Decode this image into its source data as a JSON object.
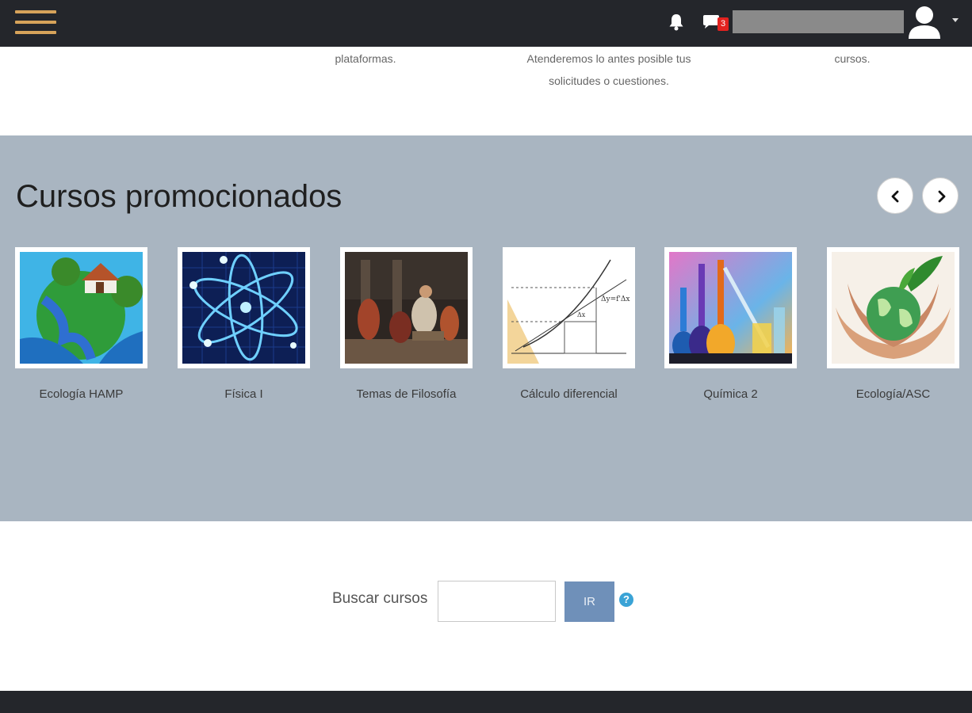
{
  "navbar": {
    "notifications_count": "3"
  },
  "info": {
    "col1": "plataformas.",
    "col2_line1": "Atenderemos lo antes posible tus",
    "col2_line2": "solicitudes o cuestiones.",
    "col3": "cursos."
  },
  "promoted": {
    "title": "Cursos promocionados",
    "courses": [
      {
        "name": "Ecología HAMP"
      },
      {
        "name": "Física I"
      },
      {
        "name": "Temas de Filosofía"
      },
      {
        "name": "Cálculo diferencial"
      },
      {
        "name": "Química 2"
      },
      {
        "name": "Ecología/ASC"
      }
    ]
  },
  "search": {
    "label": "Buscar cursos",
    "value": "",
    "button_label": "IR",
    "help_icon": "?"
  },
  "colors": {
    "navbar": "#24262b",
    "accent": "#d7a35a",
    "promo_band": "#a9b5c1",
    "search_button": "#6f90b9"
  }
}
